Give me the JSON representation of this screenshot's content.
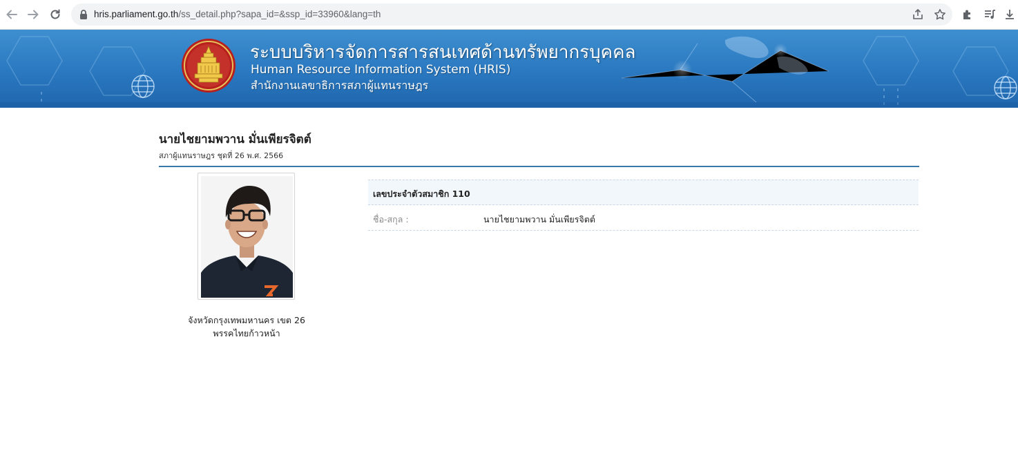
{
  "browser": {
    "url_host": "hris.parliament.go.th",
    "url_path": "/ss_detail.php?sapa_id=&ssp_id=33960&lang=th",
    "icons": [
      "back-arrow-icon",
      "forward-arrow-icon",
      "reload-icon",
      "lock-icon",
      "share-icon",
      "star-icon",
      "extensions-icon",
      "media-queue-icon",
      "download-icon"
    ]
  },
  "banner": {
    "title_th": "ระบบบริหารจัดการสารสนเทศด้านทรัพยากรบุคคล",
    "title_en": "Human Resource Information System (HRIS)",
    "org_th": "สำนักงานเลขาธิการสภาผู้แทนราษฎร",
    "emblem": "parliament-emblem"
  },
  "profile": {
    "name": "นายไชยามพวาน  มั่นเพียรจิตต์",
    "subtitle": "สภาผู้แทนราษฎร ชุดที่ 26 พ.ศ. 2566",
    "province": "จังหวัดกรุงเทพมหานคร เขต 26",
    "party": "พรรคไทยก้าวหน้า",
    "member_id_label": "เลขประจำตัวสมาชิก 110",
    "fields": [
      {
        "label": "ชื่อ-สกุล :",
        "value": "นายไชยามพวาน  มั่นเพียรจิตต์"
      }
    ]
  },
  "colors": {
    "banner": "#2a78c0",
    "rule": "#3a78a8",
    "header_row_bg": "#f2f7fc"
  }
}
